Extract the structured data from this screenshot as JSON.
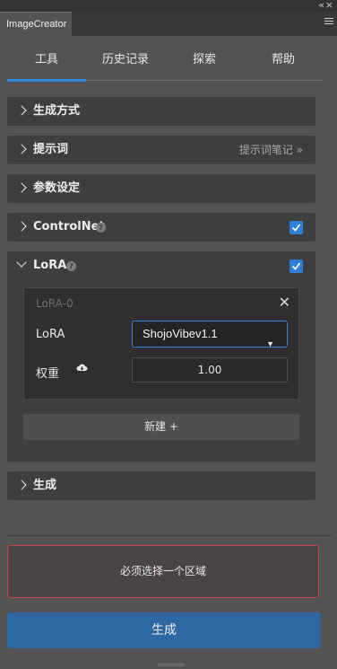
{
  "panel": {
    "title": "ImageCreator",
    "collapse_glyph": "«",
    "close_glyph": "×"
  },
  "nav": {
    "tabs": [
      "工具",
      "历史记录",
      "探索",
      "帮助"
    ],
    "active_index": 0
  },
  "sections": {
    "generation_method": "生成方式",
    "prompt": "提示词",
    "prompt_notes": "提示词笔记 »",
    "params": "参数设定",
    "controlnet": "ControlNet",
    "controlnet_checked": true,
    "lora": "LoRA",
    "lora_checked": true,
    "generate": "生成"
  },
  "lora_card": {
    "title": "LoRA-0",
    "model_label": "LoRA",
    "model_value": "ShojoVibev1.1",
    "weight_label": "权重",
    "weight_value": "1.00"
  },
  "new_button": "新建 +",
  "warning": "必须选择一个区域",
  "generate_button": "生成",
  "colors": {
    "accent": "#2d88d8",
    "warning_border": "#c24747",
    "generate_bg": "#2f66a4"
  }
}
